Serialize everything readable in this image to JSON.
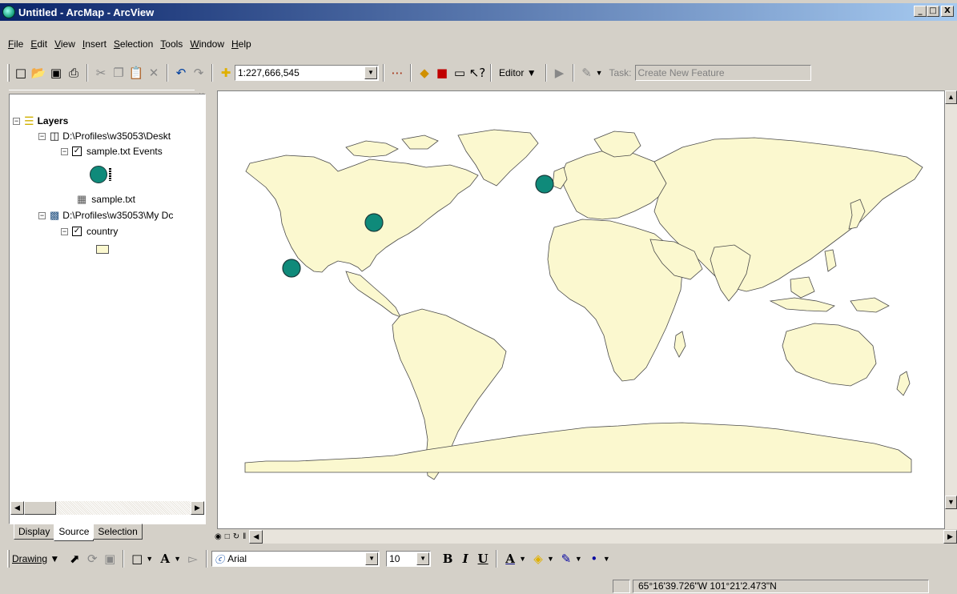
{
  "window": {
    "title": "Untitled - ArcMap - ArcView",
    "min": "_",
    "max": "□",
    "close": "X"
  },
  "menu": [
    "File",
    "Edit",
    "View",
    "Insert",
    "Selection",
    "Tools",
    "Window",
    "Help"
  ],
  "standard_toolbar": {
    "scale": "1:227,666,545",
    "editor_label": "Editor",
    "task_label": "Task:",
    "task_value": "Create New Feature"
  },
  "toc": {
    "layers_label": "Layers",
    "source1": "D:\\Profiles\\w35053\\Deskt",
    "layer1": "sample.txt Events",
    "table1": "sample.txt",
    "source2": "D:\\Profiles\\w35053\\My Dc",
    "layer2": "country",
    "tabs": [
      "Display",
      "Source",
      "Selection"
    ],
    "active_tab": "Source"
  },
  "drawing_toolbar": {
    "drawing_label": "Drawing",
    "font": "Arial",
    "size": "10",
    "bold": "B",
    "italic": "I",
    "underline": "U"
  },
  "status": {
    "coordinates": "65°16'39.726\"W  101°21'2.473\"N"
  },
  "colors": {
    "land": "#fbf8cf",
    "border": "#4a4a4a",
    "point": "#0f8a7a",
    "title_start": "#0a246a",
    "title_end": "#a6caf0"
  }
}
